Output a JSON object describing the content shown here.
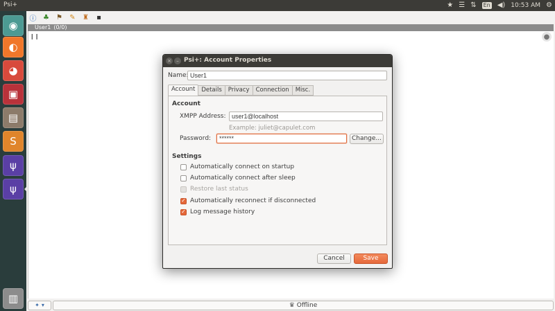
{
  "top_panel": {
    "app_title": "Psi+",
    "lang": "En",
    "volume": "◀)",
    "clock": "10:53 AM"
  },
  "launcher": {
    "items": [
      {
        "name": "dash-home-icon",
        "glyph": "◉",
        "bg": "#4c9a93"
      },
      {
        "name": "firefox-icon",
        "glyph": "◐",
        "bg": "#f0772a"
      },
      {
        "name": "chrome-beta-icon",
        "glyph": "◕",
        "bg": "#d84a3c"
      },
      {
        "name": "tool-icon",
        "glyph": "▣",
        "bg": "#b8323a"
      },
      {
        "name": "files-icon",
        "glyph": "▤",
        "bg": "#8c7b6a"
      },
      {
        "name": "sublime-text-icon",
        "glyph": "S",
        "bg": "#e0852b"
      },
      {
        "name": "psi-plus-icon",
        "glyph": "ψ",
        "bg": "#5a3fa5"
      },
      {
        "name": "psi-plus-icon-2",
        "glyph": "ψ",
        "bg": "#5a3fa5"
      },
      {
        "name": "trash-icon",
        "glyph": "🗑",
        "bg": "#8c8c8c"
      }
    ]
  },
  "psi": {
    "account_bar": {
      "name": "User1",
      "count": "(0/0)"
    },
    "roster_glyph": "❙❙",
    "status": "Offline"
  },
  "dialog": {
    "title": "Psi+: Account Properties",
    "name_label": "Name:",
    "name_value": "User1",
    "tabs": [
      "Account",
      "Details",
      "Privacy",
      "Connection",
      "Misc."
    ],
    "account_heading": "Account",
    "xmpp_label": "XMPP Address:",
    "xmpp_value": "user1@localhost",
    "xmpp_example": "Example: juliet@capulet.com",
    "password_label": "Password:",
    "password_value": "******",
    "change_button": "Change...",
    "settings_heading": "Settings",
    "options": [
      {
        "label": "Automatically connect on startup",
        "checked": false,
        "disabled": false
      },
      {
        "label": "Automatically connect after sleep",
        "checked": false,
        "disabled": false
      },
      {
        "label": "Restore last status",
        "checked": false,
        "disabled": true
      },
      {
        "label": "Automatically reconnect if disconnected",
        "checked": true,
        "disabled": false
      },
      {
        "label": "Log message history",
        "checked": true,
        "disabled": false
      }
    ],
    "cancel_button": "Cancel",
    "save_button": "Save"
  },
  "colors": {
    "accent": "#e5683a",
    "panel": "#3c3b37",
    "launcher": "#2a3d3c"
  }
}
